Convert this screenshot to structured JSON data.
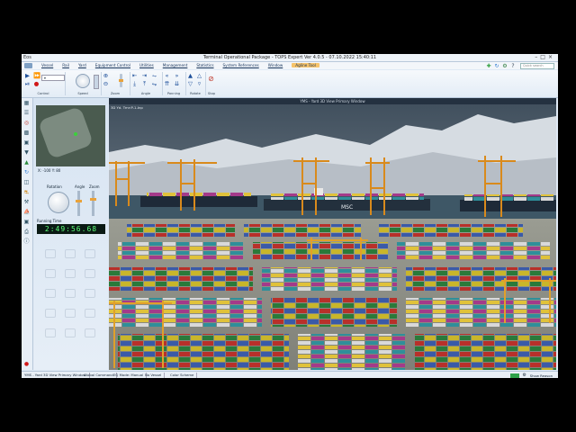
{
  "window": {
    "logo": "Eos",
    "title": "Terminal Operational Package - TOPS Expert Ver 4.0.5 - 07.10.2022 15:40:11"
  },
  "menu": {
    "items": [
      {
        "label": "Vessel"
      },
      {
        "label": "Rail"
      },
      {
        "label": "Yard"
      },
      {
        "label": "Equipment Control"
      },
      {
        "label": "Utilities"
      },
      {
        "label": "Management"
      },
      {
        "label": "Statistics"
      },
      {
        "label": "System References"
      },
      {
        "label": "Window"
      },
      {
        "label": "Agline Tool",
        "active": true
      }
    ],
    "search_placeholder": "Quick search"
  },
  "ribbon": {
    "groups": [
      {
        "label": "Control"
      },
      {
        "label": "Speed"
      },
      {
        "label": "Zoom"
      },
      {
        "label": "Angle"
      },
      {
        "label": "Panning"
      },
      {
        "label": "Rotate"
      },
      {
        "label": "Stop"
      }
    ],
    "speed_value": "5"
  },
  "nav": {
    "coords": "X: -100  Y: 80",
    "rotation_label": "Rotation",
    "angle_label": "Angle",
    "zoom_label": "Zoom",
    "running_time_label": "Running Time",
    "running_time": "2:49:56.68"
  },
  "viewport": {
    "header": "YMS - Yard 3D View Primary Window",
    "sub_label": "3D Yd. Tmr:P-1-Inp",
    "ship_label": "MSC"
  },
  "statusbar": {
    "items": [
      "YMS - Yard 3D View Primary Window",
      "Global Command",
      "EQ Mode: Manual",
      "No Vessel",
      "Color Scheme"
    ],
    "show_label": "Show Reason"
  },
  "colors": {
    "accent": "#f7c46b",
    "timer_text": "#5fff7a",
    "crane": "#d98a1c"
  }
}
